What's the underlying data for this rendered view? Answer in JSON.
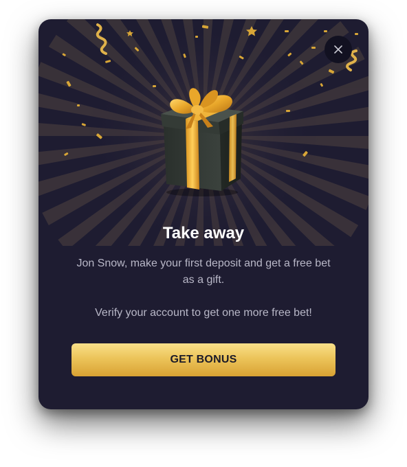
{
  "dialog": {
    "title": "Take away",
    "message_primary": "Jon Snow, make your first deposit and get a free bet as a gift.",
    "message_secondary": "Verify your account to get one more free bet!",
    "cta_label": "GET BONUS",
    "close_icon": "close-icon",
    "illustration_icon": "gift-box-icon"
  },
  "colors": {
    "modal_background": "#1e1c31",
    "title_text": "#ffffff",
    "body_text": "#b9b8c8",
    "accent_gold": "#ecc45a",
    "close_button_bg": "#121121"
  }
}
